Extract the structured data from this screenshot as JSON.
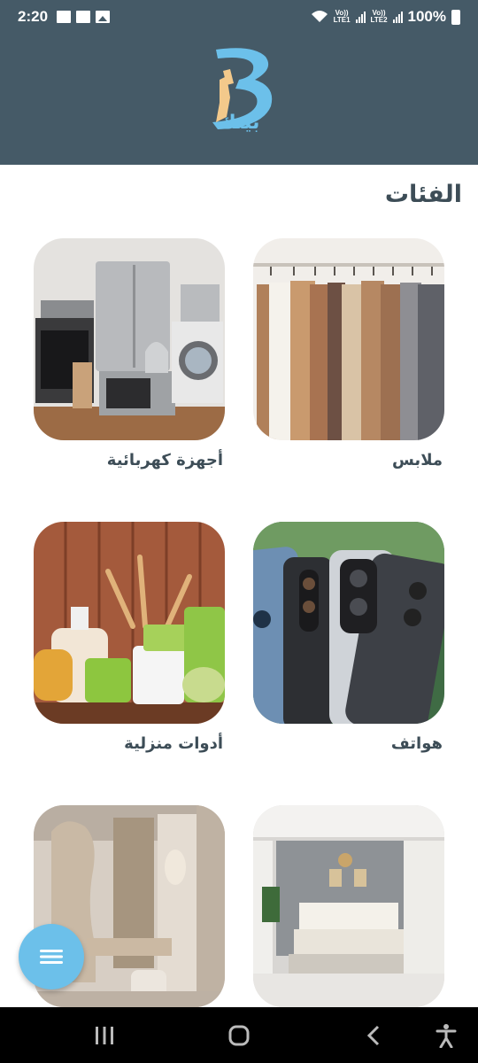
{
  "status_bar": {
    "time": "2:20",
    "sim1": "LTE1",
    "sim2": "LTE2",
    "volte": "Vo))",
    "battery": "100%"
  },
  "header": {
    "logo_text": "بيتك",
    "colors": {
      "background": "#455a67",
      "brand": "#6cc0ea"
    }
  },
  "page": {
    "title": "الفئات"
  },
  "categories": [
    {
      "label": "ملابس",
      "image": "clothes-rack"
    },
    {
      "label": "أجهزة كهربائية",
      "image": "home-appliances"
    },
    {
      "label": "هواتف",
      "image": "smartphones"
    },
    {
      "label": "أدوات منزلية",
      "image": "kitchenware"
    },
    {
      "label": "",
      "image": "bedroom"
    },
    {
      "label": "",
      "image": "interior-decor"
    }
  ],
  "fab": {
    "icon": "menu-icon"
  },
  "nav_bar": {
    "icons": [
      "recents-icon",
      "home-icon",
      "back-icon",
      "accessibility-icon"
    ]
  }
}
